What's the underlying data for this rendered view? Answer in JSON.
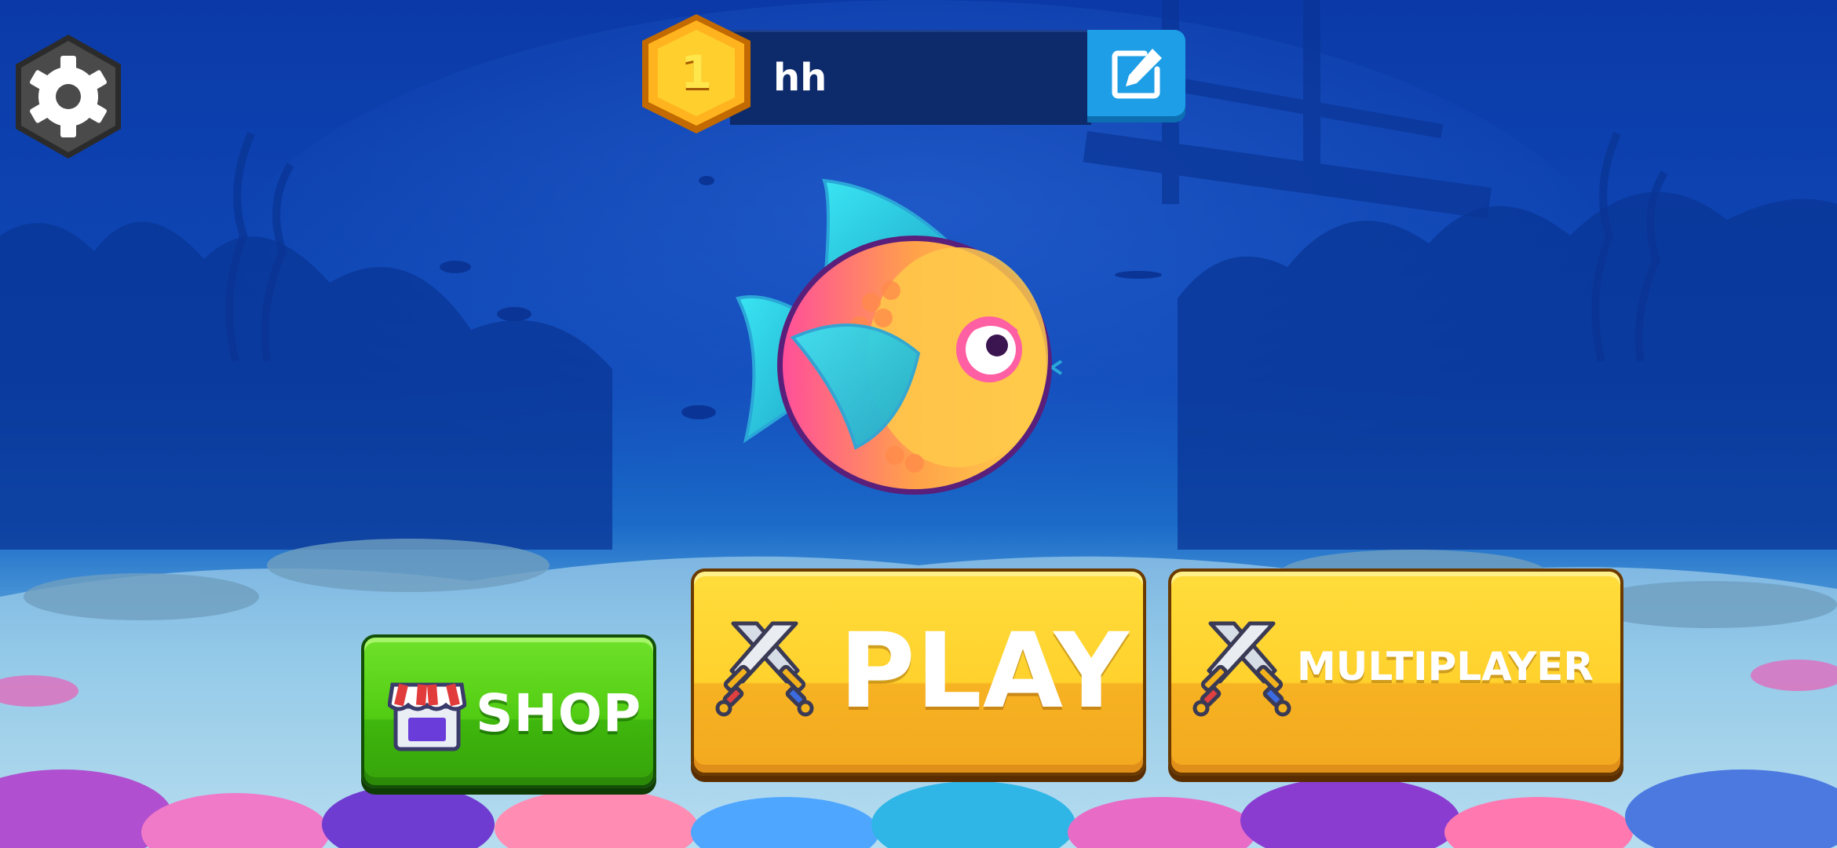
{
  "player": {
    "level": "1",
    "name": "hh"
  },
  "buttons": {
    "play": "PLAY",
    "multiplayer": "MULTIPLAYER",
    "shop": "SHOP"
  },
  "icons": {
    "settings": "gear-icon",
    "edit": "edit-icon",
    "play": "crossed-swords-icon",
    "multiplayer": "crossed-swords-icon",
    "shop": "shop-icon"
  },
  "colors": {
    "background": "#0b3aa8",
    "play_button": "#ffd12d",
    "shop_button": "#51cc12",
    "edit_button": "#1d9ee6",
    "name_bar": "#0d2a6b"
  }
}
